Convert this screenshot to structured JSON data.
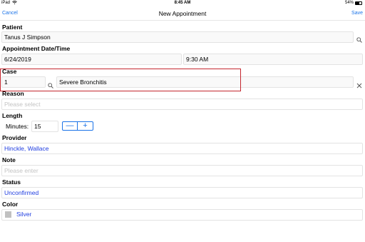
{
  "status_bar": {
    "device": "iPad",
    "time": "8:45 AM",
    "battery": "54%"
  },
  "nav": {
    "cancel": "Cancel",
    "title": "New Appointment",
    "save": "Save"
  },
  "patient": {
    "label": "Patient",
    "value": "Tanus J Simpson"
  },
  "appointment": {
    "label": "Appointment Date/Time",
    "date": "6/24/2019",
    "time": "9:30 AM"
  },
  "case": {
    "label": "Case",
    "number": "1",
    "description": "Severe Bronchitis"
  },
  "reason": {
    "label": "Reason",
    "placeholder": "Please select"
  },
  "length": {
    "label": "Length",
    "minutes_label": "Minutes:",
    "minutes_value": "15",
    "minus": "—",
    "plus": "+"
  },
  "provider": {
    "label": "Provider",
    "value": "Hinckle, Wallace"
  },
  "note": {
    "label": "Note",
    "placeholder": "Please enter"
  },
  "status": {
    "label": "Status",
    "value": "Unconfirmed"
  },
  "color": {
    "label": "Color",
    "value": "Silver",
    "swatch": "#c0c0c0"
  },
  "colors": {
    "accent": "#1a73e8",
    "value_blue": "#1f3de0",
    "highlight_red": "#c4262e"
  }
}
